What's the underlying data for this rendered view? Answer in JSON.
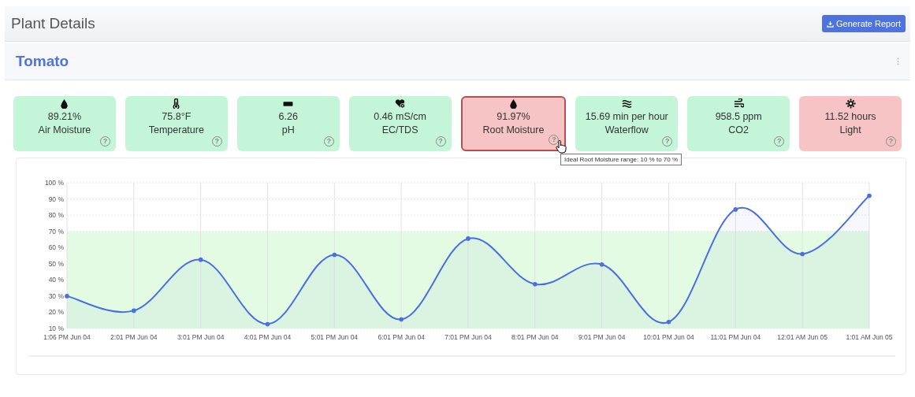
{
  "page_title": "Plant Details",
  "report_button": "Generate Report",
  "plant": {
    "name": "Tomato"
  },
  "tiles": [
    {
      "kind": "drop",
      "value": "89.21%",
      "label": "Air Moisture",
      "alert": false,
      "selected": false,
      "help": "?"
    },
    {
      "kind": "thermometer",
      "value": "75.8°F",
      "label": "Temperature",
      "alert": false,
      "selected": false,
      "help": "?"
    },
    {
      "kind": "ruler",
      "value": "6.26",
      "label": "pH",
      "alert": false,
      "selected": false,
      "help": "?"
    },
    {
      "kind": "heart",
      "value": "0.46 mS/cm",
      "label": "EC/TDS",
      "alert": false,
      "selected": false,
      "help": "?"
    },
    {
      "kind": "drop",
      "value": "91.97%",
      "label": "Root Moisture",
      "alert": true,
      "selected": true,
      "help": "?",
      "tooltip": "Ideal Root Moisture range: 10 % to 70 %"
    },
    {
      "kind": "waves",
      "value": "15.69 min per hour",
      "label": "Waterflow",
      "alert": false,
      "selected": false,
      "help": "?"
    },
    {
      "kind": "wind",
      "value": "958.5 ppm",
      "label": "CO2",
      "alert": false,
      "selected": false,
      "help": "?"
    },
    {
      "kind": "sun",
      "value": "11.52 hours",
      "label": "Light",
      "alert": true,
      "selected": false,
      "help": "?"
    }
  ],
  "chart": {
    "chart_data": {
      "type": "area",
      "grid": true,
      "categories": [
        "1:06 PM Jun 04",
        "2:01 PM Jun 04",
        "3:01 PM Jun 04",
        "4:01 PM Jun 04",
        "5:01 PM Jun 04",
        "6:01 PM Jun 04",
        "7:01 PM Jun 04",
        "8:01 PM Jun 04",
        "9:01 PM Jun 04",
        "10:01 PM Jun 04",
        "11:01 PM Jun 04",
        "12:01 AM Jun 05",
        "1:01 AM Jun 05"
      ],
      "series": [
        {
          "color": "#4a6fe0",
          "values": [
            30,
            21,
            52.5,
            12.7,
            55.5,
            15.6,
            65.5,
            37.4,
            49.5,
            14,
            83.5,
            56,
            92
          ]
        }
      ],
      "ylim": [
        10,
        100
      ],
      "yticks": [
        {
          "value": 10,
          "label": "10 %"
        },
        {
          "value": 20,
          "label": "20 %"
        },
        {
          "value": 30,
          "label": "30 %"
        },
        {
          "value": 40,
          "label": "40 %"
        },
        {
          "value": 50,
          "label": "50 %"
        },
        {
          "value": 60,
          "label": "60 %"
        },
        {
          "value": 70,
          "label": "70 %"
        },
        {
          "value": 80,
          "label": "80 %"
        },
        {
          "value": 90,
          "label": "90 %"
        },
        {
          "value": 100,
          "label": "100 %"
        }
      ],
      "bands": [
        {
          "axis": "y",
          "from": 10,
          "to": 70,
          "color": "#e3fbe3"
        }
      ]
    }
  }
}
